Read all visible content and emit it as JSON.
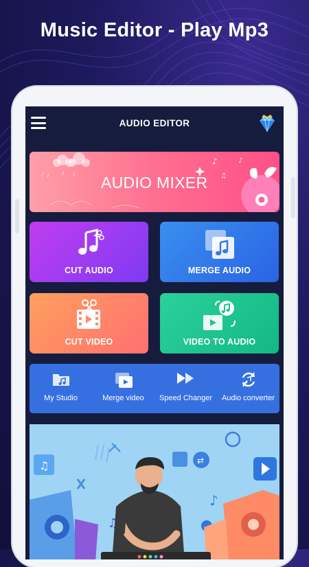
{
  "headline": "Music Editor - Play Mp3",
  "header": {
    "title": "AUDIO EDITOR",
    "menu_icon": "hamburger-menu-icon",
    "premium_icon": "diamond-crown-icon"
  },
  "banner": {
    "label": "AUDIO MIXER",
    "colors": [
      "#ff9fa7",
      "#ff4f88"
    ]
  },
  "tiles": [
    {
      "label": "CUT AUDIO",
      "icon": "music-note-scissors-icon"
    },
    {
      "label": "MERGE AUDIO",
      "icon": "merge-audio-icon"
    },
    {
      "label": "CUT VIDEO",
      "icon": "film-scissors-icon"
    },
    {
      "label": "VIDEO TO AUDIO",
      "icon": "video-to-audio-icon"
    }
  ],
  "quick_actions": [
    {
      "label": "My Studio",
      "icon": "folder-music-icon"
    },
    {
      "label": "Merge video",
      "icon": "merge-video-icon"
    },
    {
      "label": "Speed Changer",
      "icon": "fast-forward-icon"
    },
    {
      "label": "Audio converter",
      "icon": "convert-arrows-icon"
    }
  ],
  "colors": {
    "screen_bg": "#151c3d",
    "quickbar": "#3670e0",
    "cut_audio": "#9b3cf1",
    "merge_audio": "#3278ea",
    "cut_video": "#ff8a66",
    "video_to_audio": "#1fc48f"
  }
}
